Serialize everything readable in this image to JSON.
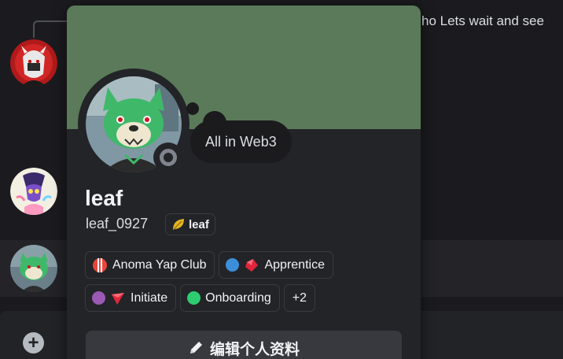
{
  "chat": {
    "message_fragment": "ho  Lets wait and see"
  },
  "profile": {
    "custom_status": "All in Web3",
    "display_name": "leaf",
    "username": "leaf_0927",
    "server_tag": "leaf",
    "status": "offline",
    "banner_color": "#5a7a5a"
  },
  "roles": [
    {
      "label": "Anoma Yap Club",
      "dot_color": "#e8453c",
      "emoji": ""
    },
    {
      "label": "Apprentice",
      "dot_color": "#3b8fd9",
      "emoji": "red-gem"
    },
    {
      "label": "Initiate",
      "dot_color": "#9b59b6",
      "emoji": "red-arrow"
    },
    {
      "label": "Onboarding",
      "dot_color": "#2ecc71",
      "emoji": ""
    },
    {
      "label": "+2"
    }
  ],
  "actions": {
    "edit_profile_label": "编辑个人资料"
  }
}
